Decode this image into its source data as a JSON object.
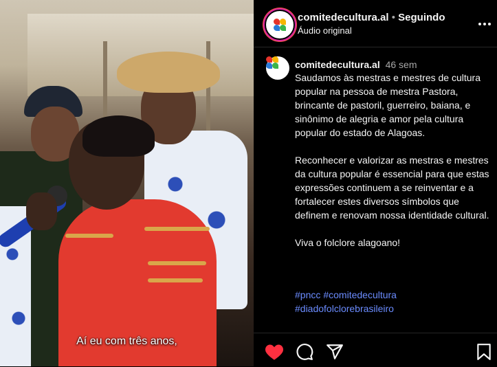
{
  "media": {
    "subtitle": "Aí eu com três anos,"
  },
  "header": {
    "username": "comitedecultura.al",
    "separator": "•",
    "follow_status": "Seguindo",
    "audio": "Áudio original",
    "more_icon": "more-horizontal-icon"
  },
  "comment": {
    "username": "comitedecultura.al",
    "time": "46 sem",
    "caption": "Saudamos às mestras e mestres de cultura popular na pessoa de mestra Pastora, brincante de pastoril, guerreiro, baiana, e sinônimo de alegria e amor pela cultura popular do estado de Alagoas.\n\nReconhecer e valorizar as mestras e mestres da cultura popular é essencial para que estas expressões continuem a se reinventar e a fortalecer estes diversos símbolos que definem e renovam nossa identidade cultural.\n\nViva o folclore alagoano!",
    "hashtags": [
      "#pncc",
      "#comitedecultura",
      "#diadofolclorebrasileiro"
    ]
  },
  "actions": {
    "like_icon": "heart-filled-icon",
    "comment_icon": "comment-icon",
    "share_icon": "send-icon",
    "save_icon": "bookmark-icon",
    "like_color": "#ff3040"
  },
  "colors": {
    "background": "#000000",
    "link": "#6b8cff",
    "secondary_text": "#a8a8a8"
  }
}
